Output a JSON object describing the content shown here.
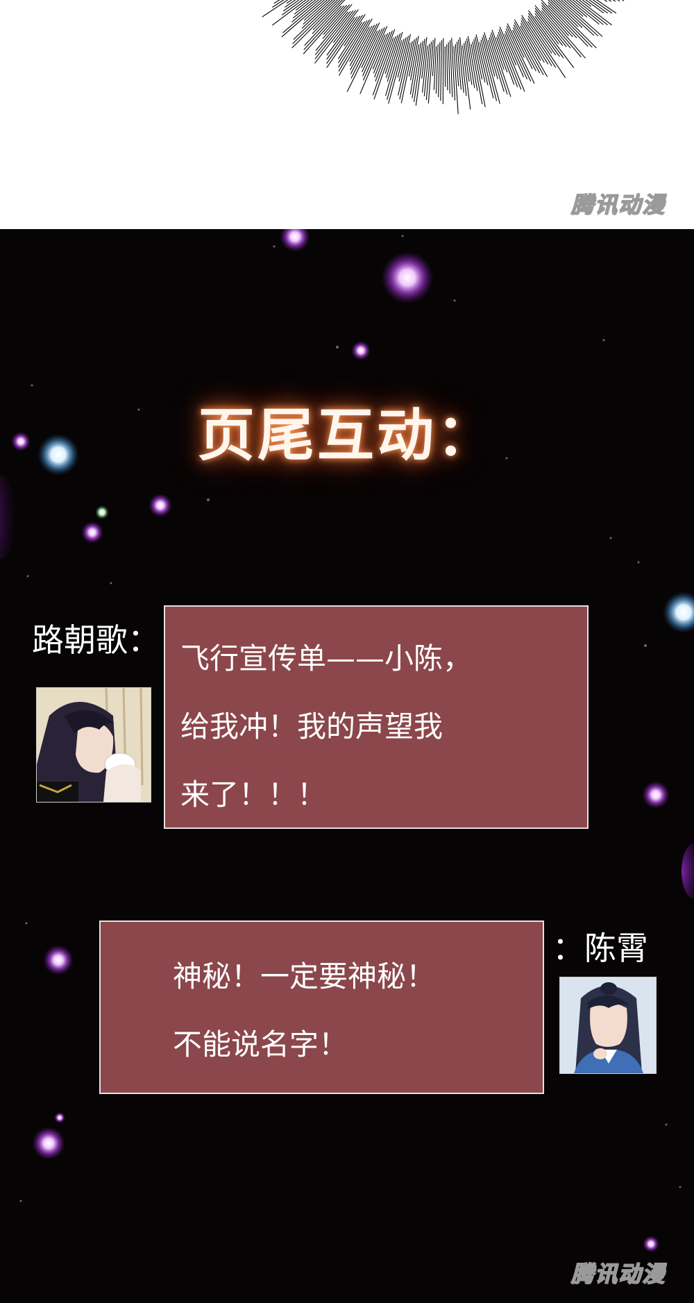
{
  "watermark": {
    "text": "腾讯动漫"
  },
  "panel": {
    "headline": "页尾互动："
  },
  "dialogue": [
    {
      "speaker": "路朝歌：",
      "avatar_icon": "character-portrait-lu-zhaoge",
      "lines": [
        "飞行宣传单——小陈，",
        "给我冲！我的声望我",
        "来了！！！"
      ]
    },
    {
      "speaker": "：陈霄",
      "avatar_icon": "character-portrait-chen-xiao",
      "lines": [
        "神秘！一定要神秘！",
        "不能说名字！"
      ]
    }
  ],
  "colors": {
    "background": "#070405",
    "bubble": "#8b474b",
    "headline_glow": "#d8622a"
  }
}
